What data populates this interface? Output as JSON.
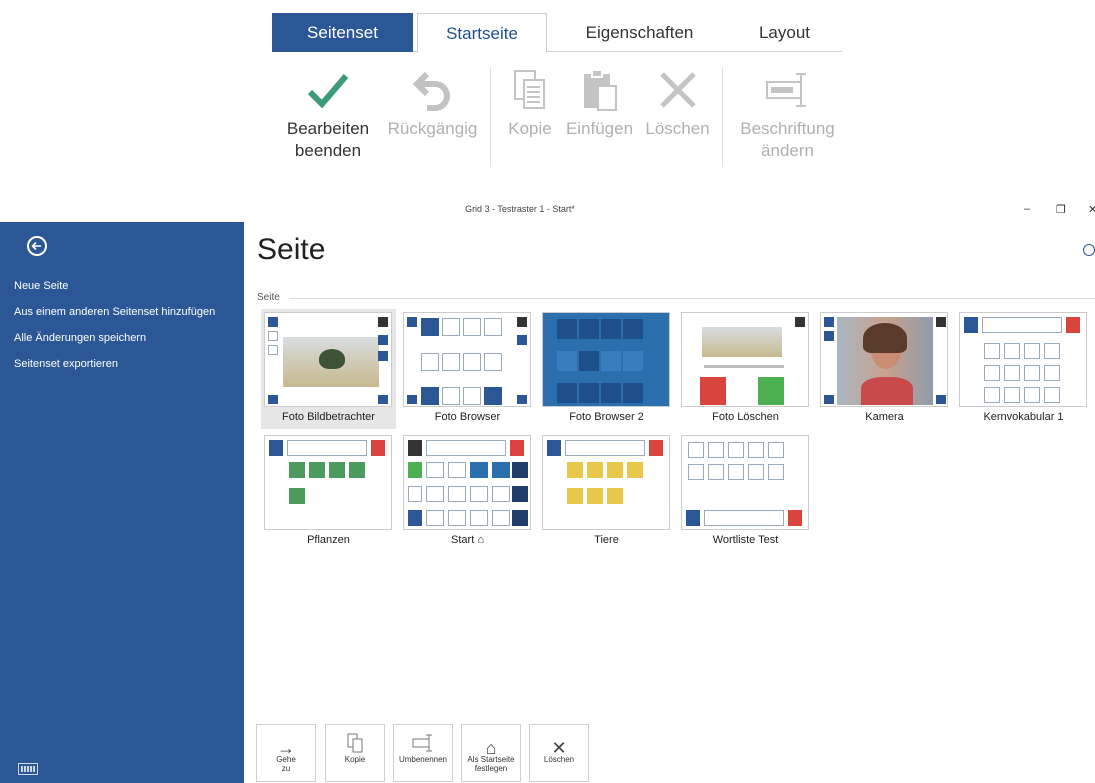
{
  "ribbon": {
    "tabs": [
      "Seitenset",
      "Startseite",
      "Eigenschaften",
      "Layout"
    ],
    "buttons": {
      "finish_l1": "Bearbeiten",
      "finish_l2": "beenden",
      "undo": "Rückgängig",
      "copy": "Kopie",
      "paste": "Einfügen",
      "delete": "Löschen",
      "caption_l1": "Beschriftung",
      "caption_l2": "ändern"
    }
  },
  "window": {
    "title": "Grid 3 - Testraster 1 - Start*",
    "min": "–",
    "max": "❐",
    "close": "✕"
  },
  "sidebar": {
    "items": [
      "Neue Seite",
      "Aus einem anderen Seitenset hinzufügen",
      "Alle Änderungen speichern",
      "Seitenset exportieren"
    ]
  },
  "main": {
    "title": "Seite",
    "section": "Seite"
  },
  "pages": [
    {
      "label": "Foto Bildbetrachter"
    },
    {
      "label": "Foto Browser"
    },
    {
      "label": "Foto Browser 2"
    },
    {
      "label": "Foto Löschen"
    },
    {
      "label": "Kamera"
    },
    {
      "label": "Kernvokabular 1"
    },
    {
      "label": "Pflanzen"
    },
    {
      "label": "Start"
    },
    {
      "label": "Tiere"
    },
    {
      "label": "Wortliste Test"
    }
  ],
  "bottom": {
    "goto_l1": "Gehe",
    "goto_l2": "zu",
    "copy": "Kopie",
    "rename": "Umbenennen",
    "home_l1": "Als Startseite",
    "home_l2": "festlegen",
    "delete": "Löschen"
  },
  "colors": {
    "accent": "#2c5797",
    "check": "#3d9b7c",
    "red": "#d9453d",
    "green": "#4caf50"
  }
}
